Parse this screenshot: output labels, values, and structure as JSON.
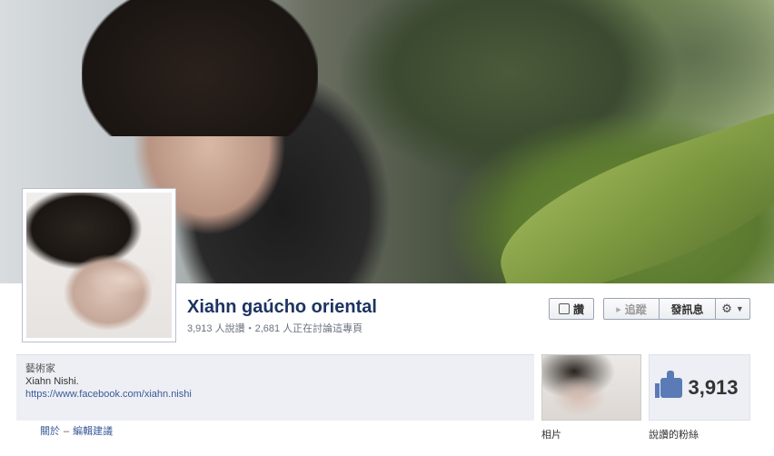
{
  "page": {
    "name": "Xiahn gaúcho oriental",
    "stats": "3,913 人說讚・2,681 人正在討論這專頁"
  },
  "actions": {
    "like_label": "讚",
    "follow_label": "追蹤",
    "message_label": "發訊息"
  },
  "info": {
    "category": "藝術家",
    "description": "Xiahn Nishi.",
    "url": "https://www.facebook.com/xiahn.nishi"
  },
  "about_links": {
    "about": "關於",
    "dash": "–",
    "suggest_edits": "編輯建議"
  },
  "photos": {
    "label": "相片"
  },
  "likes": {
    "count": "3,913",
    "label": "說讚的粉絲"
  },
  "icons": {
    "like": "thumbs-up-icon",
    "follow": "rss-icon",
    "settings": "gear-icon",
    "dropdown": "caret-down-icon"
  },
  "colors": {
    "brand": "#3b5998",
    "name": "#1d3462",
    "panel_bg": "#edeff4",
    "like_thumb": "#5b7bb7"
  }
}
